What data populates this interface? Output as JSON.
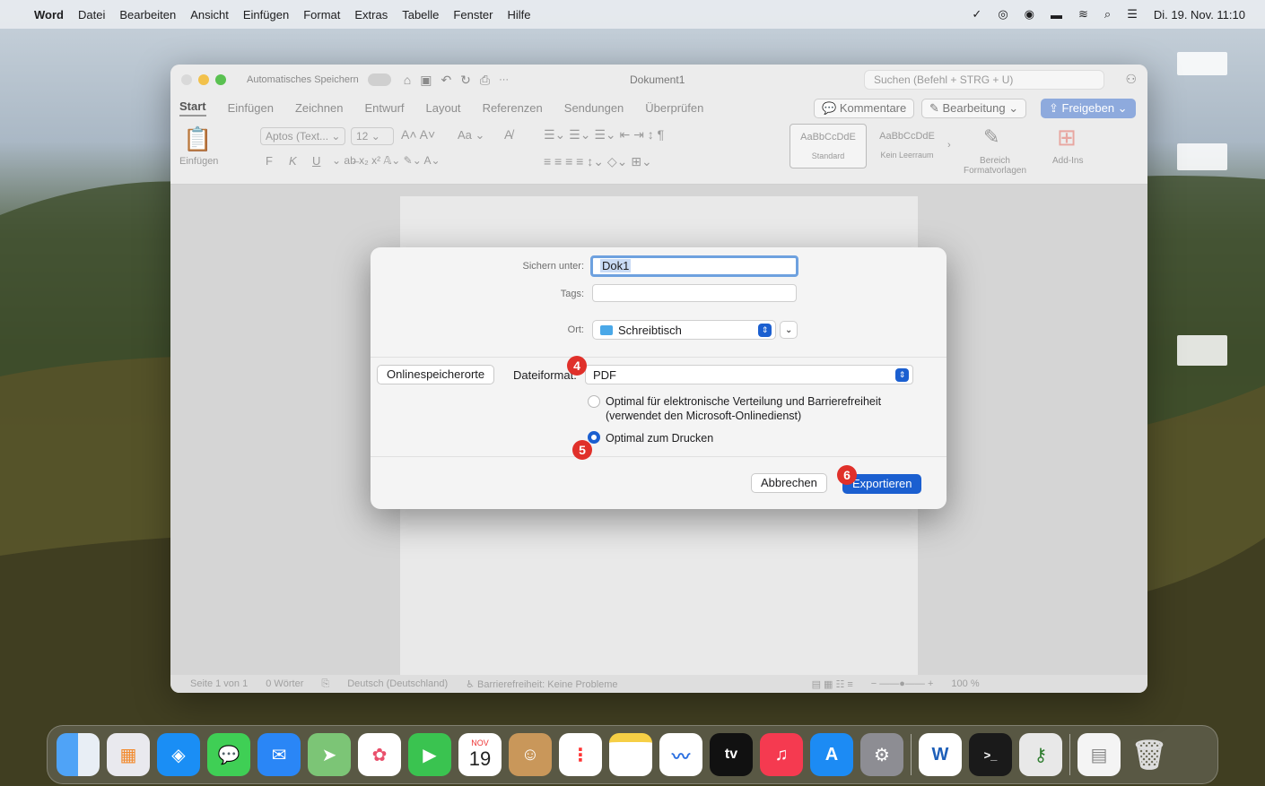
{
  "menubar": {
    "app_name": "Word",
    "items": [
      "Datei",
      "Bearbeiten",
      "Ansicht",
      "Einfügen",
      "Format",
      "Extras",
      "Tabelle",
      "Fenster",
      "Hilfe"
    ],
    "clock": "Di. 19. Nov. 11:10"
  },
  "window": {
    "autosave_label": "Automatisches Speichern",
    "doc_title": "Dokument1",
    "search_placeholder": "Suchen (Befehl + STRG + U)",
    "tabs": [
      "Start",
      "Einfügen",
      "Zeichnen",
      "Entwurf",
      "Layout",
      "Referenzen",
      "Sendungen",
      "Überprüfen"
    ],
    "comments_button": "Kommentare",
    "editing_button": "Bearbeitung",
    "share_button": "Freigeben",
    "ribbon": {
      "paste_label": "Einfügen",
      "font_name": "Aptos (Text...",
      "font_size": "12",
      "style_standard": "Standard",
      "style_no_spacing": "Kein Leerraum",
      "style_preview": "AaBbCcDdE",
      "styles_pane_label_1": "Bereich",
      "styles_pane_label_2": "Formatvorlagen",
      "addins_label": "Add-Ins",
      "bold": "F",
      "italic": "K",
      "underline": "U"
    },
    "status": {
      "page": "Seite 1 von 1",
      "words": "0 Wörter",
      "language": "Deutsch (Deutschland)",
      "accessibility": "Barrierefreiheit: Keine Probleme",
      "zoom": "100 %"
    }
  },
  "dialog": {
    "save_as_label": "Sichern unter:",
    "save_as_value": "Dok1",
    "tags_label": "Tags:",
    "location_label": "Ort:",
    "location_value": "Schreibtisch",
    "online_locations_button": "Onlinespeicherorte",
    "format_label": "Dateiformat:",
    "format_value": "PDF",
    "option_electronic_line1": "Optimal für elektronische Verteilung und Barrierefreiheit",
    "option_electronic_line2": "(verwendet den Microsoft-Onlinedienst)",
    "option_print": "Optimal zum Drucken",
    "selected_option": "print",
    "cancel_button": "Abbrechen",
    "export_button": "Exportieren"
  },
  "steps": [
    "4",
    "5",
    "6"
  ],
  "dock": {
    "icons": [
      "finder-icon",
      "launchpad-icon",
      "safari-icon",
      "messages-icon",
      "mail-icon",
      "maps-icon",
      "photos-icon",
      "facetime-icon",
      "calendar-icon",
      "contacts-icon",
      "reminders-icon",
      "notes-icon",
      "freeform-icon",
      "tv-icon",
      "music-icon",
      "app-store-icon",
      "system-settings-icon",
      "word-icon",
      "terminal-icon",
      "keychain-icon",
      "document-icon",
      "trash-icon"
    ],
    "calendar_month": "NOV",
    "calendar_day": "19",
    "tv_label": "tv"
  },
  "colors": {
    "accent": "#1b5fd0",
    "step_badge": "#e0302a"
  }
}
